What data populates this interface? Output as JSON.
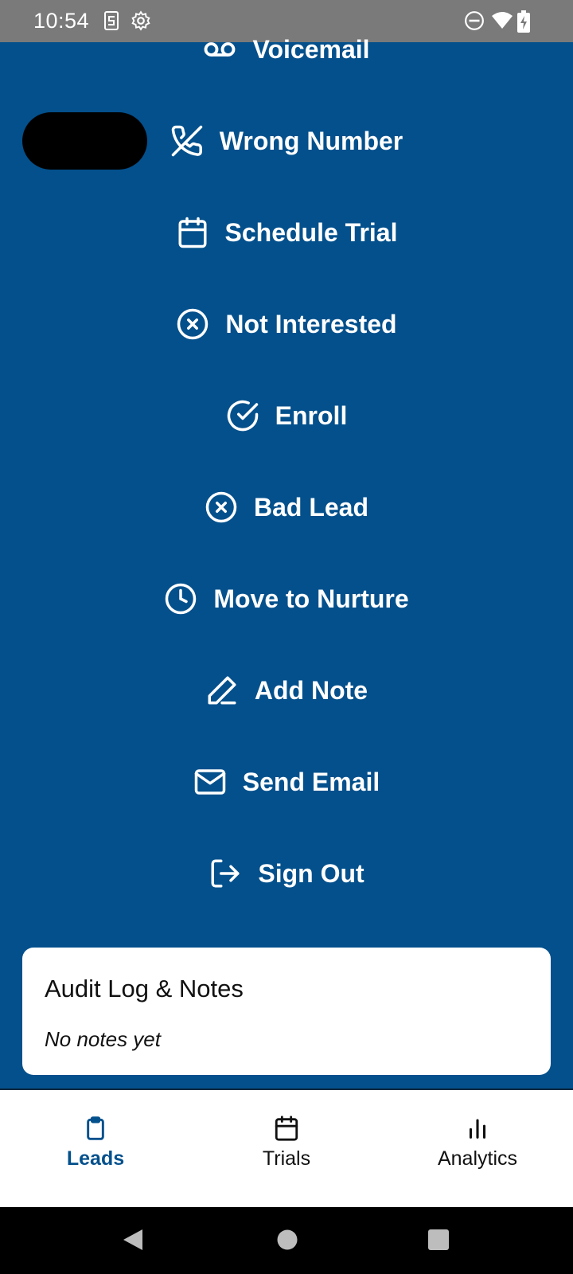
{
  "status_bar": {
    "time": "10:54",
    "left_icons": [
      "s-notification-icon",
      "settings-icon"
    ],
    "right_icons": [
      "do-not-disturb-icon",
      "wifi-icon",
      "battery-charging-icon"
    ]
  },
  "actions": [
    {
      "label": "Voicemail",
      "icon": "voicemail-icon"
    },
    {
      "label": "Wrong Number",
      "icon": "phone-off-icon"
    },
    {
      "label": "Schedule Trial",
      "icon": "calendar-icon"
    },
    {
      "label": "Not Interested",
      "icon": "x-circle-icon"
    },
    {
      "label": "Enroll",
      "icon": "check-circle-icon"
    },
    {
      "label": "Bad Lead",
      "icon": "x-circle-icon"
    },
    {
      "label": "Move to Nurture",
      "icon": "clock-icon"
    },
    {
      "label": "Add Note",
      "icon": "pencil-icon"
    },
    {
      "label": "Send Email",
      "icon": "mail-icon"
    },
    {
      "label": "Sign Out",
      "icon": "log-out-icon"
    }
  ],
  "audit": {
    "title": "Audit Log & Notes",
    "empty_text": "No notes yet"
  },
  "bottom_nav": {
    "items": [
      {
        "label": "Leads",
        "icon": "clipboard-icon",
        "active": true
      },
      {
        "label": "Trials",
        "icon": "calendar-icon",
        "active": false
      },
      {
        "label": "Analytics",
        "icon": "bar-chart-icon",
        "active": false
      }
    ]
  },
  "colors": {
    "primary": "#03508c",
    "status_bar": "#7a7a7a",
    "card": "#ffffff"
  }
}
